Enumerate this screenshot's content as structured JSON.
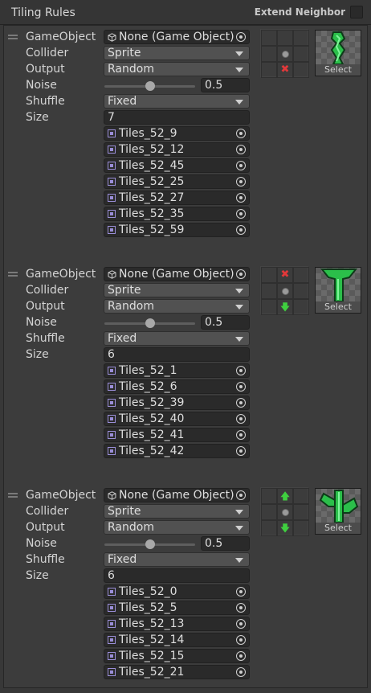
{
  "header": {
    "title": "Tiling Rules",
    "extend_label": "Extend Neighbor"
  },
  "labels": {
    "gameobject": "GameObject",
    "collider": "Collider",
    "output": "Output",
    "noise": "Noise",
    "shuffle": "Shuffle",
    "size": "Size",
    "select": "Select"
  },
  "rules": [
    {
      "gameobject": "None (Game Object)",
      "collider": "Sprite",
      "output": "Random",
      "noise": "0.5",
      "noise_level": 0.5,
      "shuffle": "Fixed",
      "size": "7",
      "tiles": [
        "Tiles_52_9",
        "Tiles_52_12",
        "Tiles_52_45",
        "Tiles_52_25",
        "Tiles_52_27",
        "Tiles_52_35",
        "Tiles_52_59"
      ]
    },
    {
      "gameobject": "None (Game Object)",
      "collider": "Sprite",
      "output": "Random",
      "noise": "0.5",
      "noise_level": 0.5,
      "shuffle": "Fixed",
      "size": "6",
      "tiles": [
        "Tiles_52_1",
        "Tiles_52_6",
        "Tiles_52_39",
        "Tiles_52_40",
        "Tiles_52_41",
        "Tiles_52_42"
      ]
    },
    {
      "gameobject": "None (Game Object)",
      "collider": "Sprite",
      "output": "Random",
      "noise": "0.5",
      "noise_level": 0.5,
      "shuffle": "Fixed",
      "size": "6",
      "tiles": [
        "Tiles_52_0",
        "Tiles_52_5",
        "Tiles_52_13",
        "Tiles_52_14",
        "Tiles_52_15",
        "Tiles_52_21"
      ]
    }
  ],
  "icons": {
    "object": "cube-icon",
    "picker": "object-picker-icon",
    "tile": "tile-asset-icon",
    "not_neighbor": "red-x-icon",
    "neighbor_up": "green-arrow-up-icon",
    "neighbor_down": "green-arrow-down-icon",
    "center": "center-dot-icon"
  },
  "colors": {
    "not_neighbor": "#e2383a",
    "neighbor": "#3fcf3f",
    "sprite_green": "#2bbf4a"
  }
}
